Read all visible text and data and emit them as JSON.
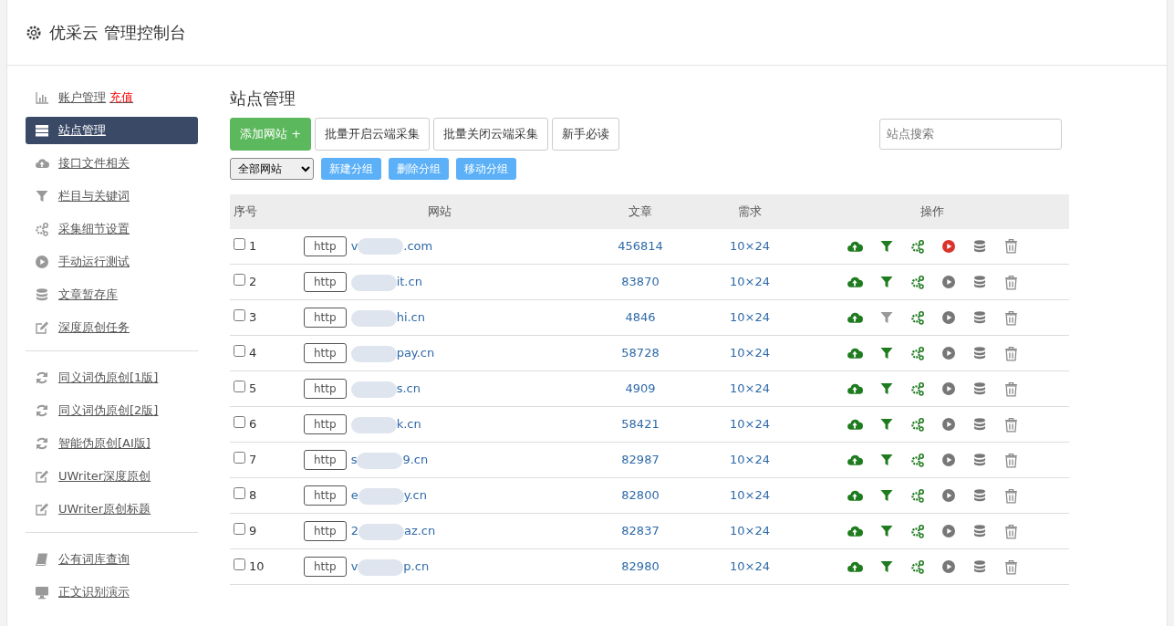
{
  "header": {
    "title": "优采云 管理控制台"
  },
  "sidebar": {
    "groups": [
      [
        {
          "kind": "chart",
          "label": "账户管理",
          "badge": "充值",
          "selected": false
        },
        {
          "kind": "server",
          "label": "站点管理",
          "selected": true
        },
        {
          "kind": "cloud",
          "label": "接口文件相关",
          "selected": false
        },
        {
          "kind": "filter",
          "label": "栏目与关键词",
          "selected": false
        },
        {
          "kind": "gears",
          "label": "采集细节设置",
          "selected": false
        },
        {
          "kind": "play",
          "label": "手动运行测试",
          "selected": false
        },
        {
          "kind": "database",
          "label": "文章暂存库",
          "selected": false
        },
        {
          "kind": "edit",
          "label": "深度原创任务",
          "selected": false
        }
      ],
      [
        {
          "kind": "refresh",
          "label": "同义词伪原创[1版]",
          "selected": false
        },
        {
          "kind": "refresh",
          "label": "同义词伪原创[2版]",
          "selected": false
        },
        {
          "kind": "refresh",
          "label": "智能伪原创[AI版]",
          "selected": false
        },
        {
          "kind": "edit",
          "label": "UWriter深度原创",
          "selected": false
        },
        {
          "kind": "edit",
          "label": "UWriter原创标题",
          "selected": false
        }
      ],
      [
        {
          "kind": "book",
          "label": "公有词库查询",
          "selected": false
        },
        {
          "kind": "monitor",
          "label": "正文识别演示",
          "selected": false
        }
      ]
    ]
  },
  "main": {
    "title": "站点管理",
    "buttons": [
      {
        "kind": "primary",
        "label": "添加网站 +"
      },
      {
        "kind": "default",
        "label": "批量开启云端采集"
      },
      {
        "kind": "default",
        "label": "批量关闭云端采集"
      },
      {
        "kind": "default",
        "label": "新手必读"
      }
    ],
    "search": {
      "placeholder": "站点搜索"
    },
    "group_select": {
      "value": "全部网站"
    },
    "group_buttons": [
      "新建分组",
      "删除分组",
      "移动分组"
    ],
    "table": {
      "columns": [
        "序号",
        "网站",
        "文章",
        "需求",
        "操作"
      ],
      "rows": [
        {
          "index": "1",
          "checked": false,
          "protocol": "http",
          "site_start": "v",
          "site_end": ".com",
          "articles": "456814",
          "demand": "10×24",
          "filter_on": true,
          "running": true
        },
        {
          "index": "2",
          "checked": false,
          "protocol": "http",
          "site_start": "",
          "site_end": "it.cn",
          "articles": "83870",
          "demand": "10×24",
          "filter_on": true,
          "running": false
        },
        {
          "index": "3",
          "checked": false,
          "protocol": "http",
          "site_start": "",
          "site_end": "hi.cn",
          "articles": "4846",
          "demand": "10×24",
          "filter_on": false,
          "running": false
        },
        {
          "index": "4",
          "checked": false,
          "protocol": "http",
          "site_start": "",
          "site_end": "pay.cn",
          "articles": "58728",
          "demand": "10×24",
          "filter_on": true,
          "running": false
        },
        {
          "index": "5",
          "checked": false,
          "protocol": "http",
          "site_start": "",
          "site_end": "s.cn",
          "articles": "4909",
          "demand": "10×24",
          "filter_on": true,
          "running": false
        },
        {
          "index": "6",
          "checked": false,
          "protocol": "http",
          "site_start": "",
          "site_end": "k.cn",
          "articles": "58421",
          "demand": "10×24",
          "filter_on": true,
          "running": false
        },
        {
          "index": "7",
          "checked": false,
          "protocol": "http",
          "site_start": "s",
          "site_end": "9.cn",
          "articles": "82987",
          "demand": "10×24",
          "filter_on": true,
          "running": false
        },
        {
          "index": "8",
          "checked": false,
          "protocol": "http",
          "site_start": "e",
          "site_end": "y.cn",
          "articles": "82800",
          "demand": "10×24",
          "filter_on": true,
          "running": false
        },
        {
          "index": "9",
          "checked": false,
          "protocol": "http",
          "site_start": "2",
          "site_end": "az.cn",
          "articles": "82837",
          "demand": "10×24",
          "filter_on": true,
          "running": false
        },
        {
          "index": "10",
          "checked": false,
          "protocol": "http",
          "site_start": "v",
          "site_end": "p.cn",
          "articles": "82980",
          "demand": "10×24",
          "filter_on": true,
          "running": false
        }
      ]
    }
  }
}
